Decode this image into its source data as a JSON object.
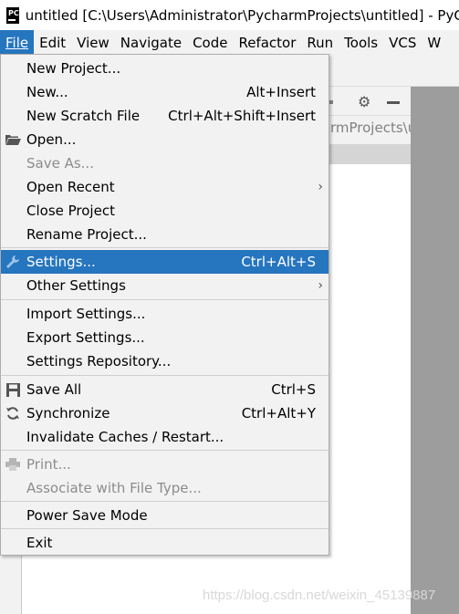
{
  "window": {
    "app_icon_text": "PC",
    "title": "untitled [C:\\Users\\Administrator\\PycharmProjects\\untitled] - PyCh"
  },
  "menubar": {
    "items": [
      {
        "label": "File",
        "active": true
      },
      {
        "label": "Edit"
      },
      {
        "label": "View"
      },
      {
        "label": "Navigate"
      },
      {
        "label": "Code"
      },
      {
        "label": "Refactor"
      },
      {
        "label": "Run"
      },
      {
        "label": "Tools"
      },
      {
        "label": "VCS"
      },
      {
        "label": "W"
      }
    ]
  },
  "background": {
    "path_text": "rmProjects\\u",
    "watermark": "https://blog.csdn.net/weixin_45139887"
  },
  "file_menu": {
    "items": [
      {
        "label": "New Project...",
        "shortcut": ""
      },
      {
        "label": "New...",
        "shortcut": "Alt+Insert"
      },
      {
        "label": "New Scratch File",
        "shortcut": "Ctrl+Alt+Shift+Insert"
      },
      {
        "label": "Open...",
        "shortcut": "",
        "icon": "folder-open-icon"
      },
      {
        "label": "Save As...",
        "shortcut": "",
        "disabled": true
      },
      {
        "label": "Open Recent",
        "submenu": true
      },
      {
        "label": "Close Project",
        "shortcut": ""
      },
      {
        "label": "Rename Project...",
        "shortcut": ""
      },
      {
        "label": "Settings...",
        "shortcut": "Ctrl+Alt+S",
        "icon": "wrench-icon",
        "selected": true
      },
      {
        "label": "Other Settings",
        "submenu": true
      },
      {
        "label": "Import Settings...",
        "shortcut": ""
      },
      {
        "label": "Export Settings...",
        "shortcut": ""
      },
      {
        "label": "Settings Repository...",
        "shortcut": ""
      },
      {
        "label": "Save All",
        "shortcut": "Ctrl+S",
        "icon": "floppy-disk-icon"
      },
      {
        "label": "Synchronize",
        "shortcut": "Ctrl+Alt+Y",
        "icon": "sync-icon"
      },
      {
        "label": "Invalidate Caches / Restart...",
        "shortcut": ""
      },
      {
        "label": "Print...",
        "shortcut": "",
        "icon": "printer-icon",
        "disabled": true
      },
      {
        "label": "Associate with File Type...",
        "shortcut": "",
        "disabled": true
      },
      {
        "label": "Power Save Mode",
        "shortcut": ""
      },
      {
        "label": "Exit",
        "shortcut": ""
      }
    ]
  },
  "colors": {
    "selection": "#2675bf",
    "menu_bg": "#f2f2f2",
    "disabled_text": "#8c8c8c"
  }
}
